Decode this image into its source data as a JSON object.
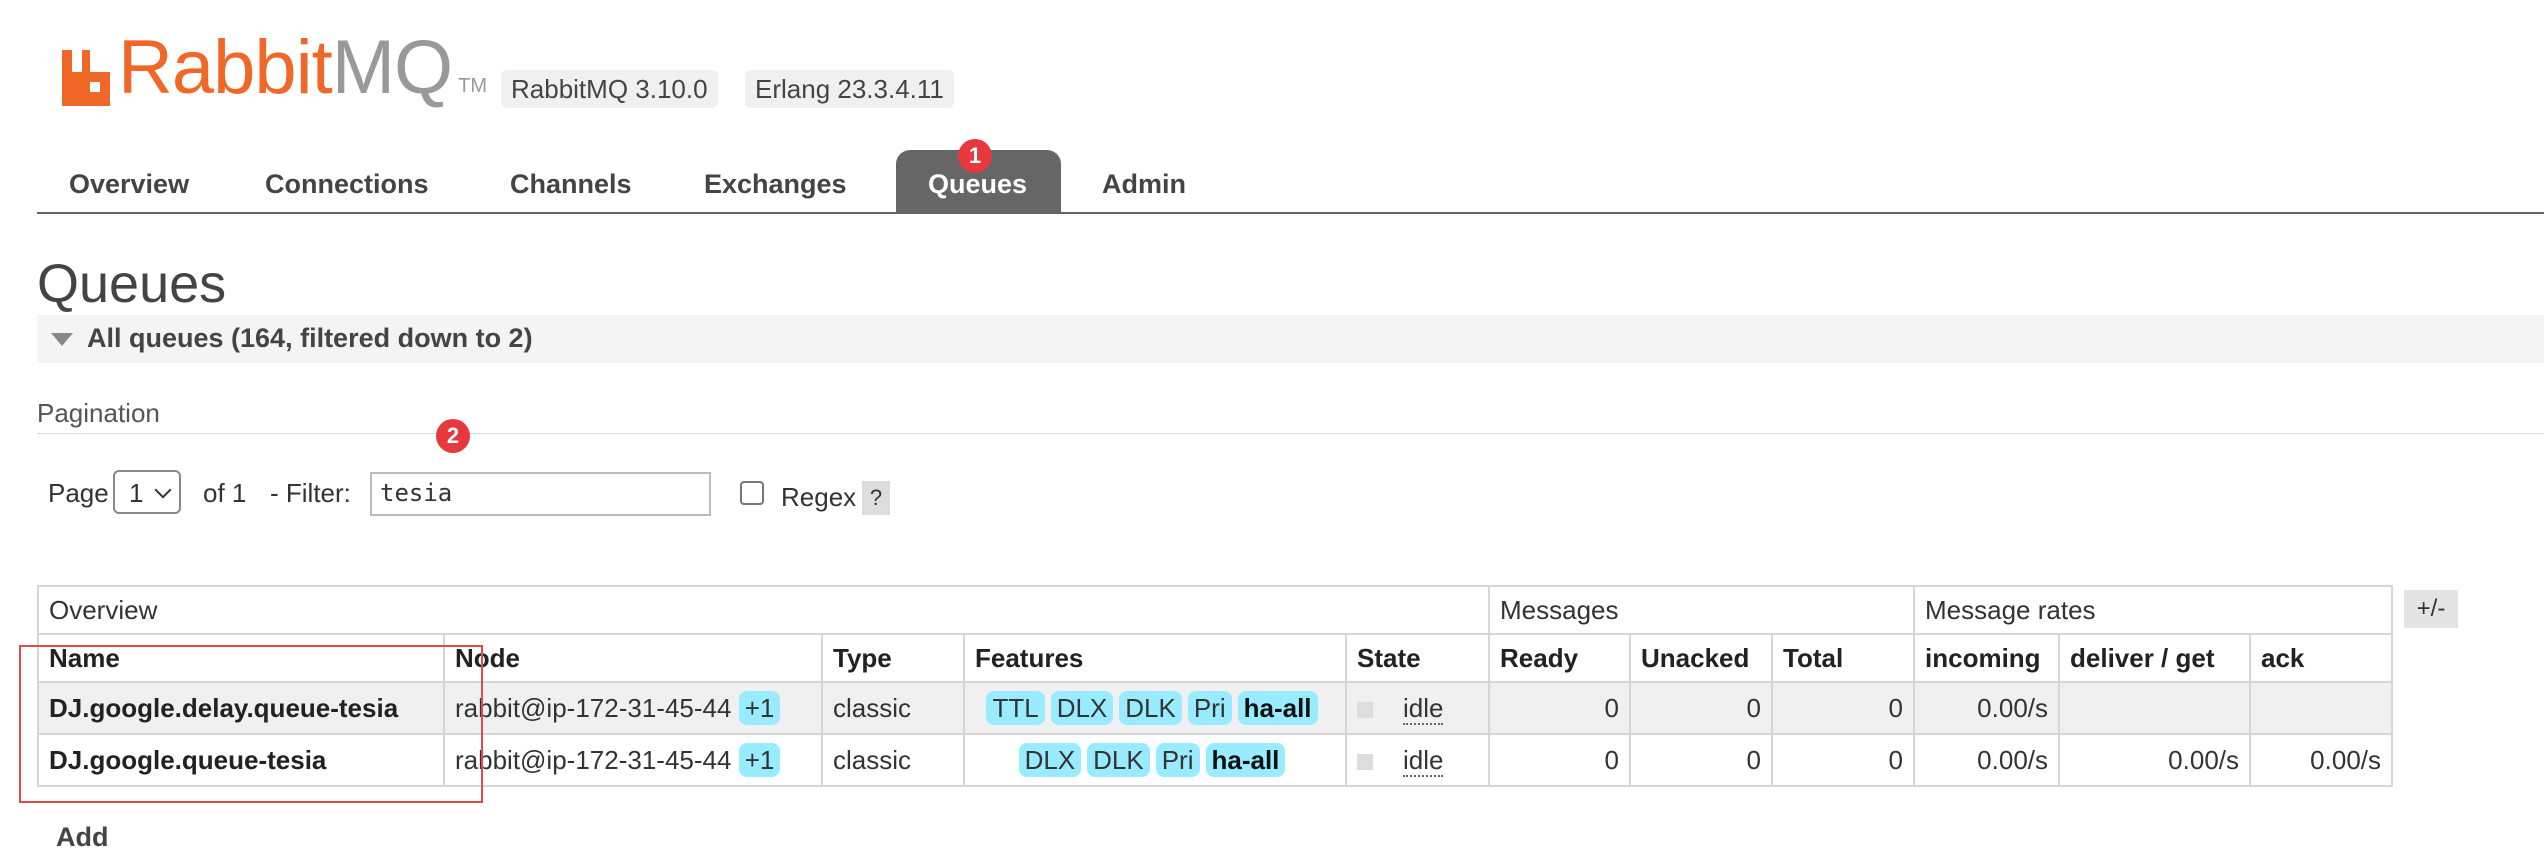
{
  "header": {
    "logo_text_primary": "Rabbit",
    "logo_text_secondary": "MQ",
    "logo_tm": "TM",
    "rabbitmq_version": "RabbitMQ 3.10.0",
    "erlang_version": "Erlang 23.3.4.11"
  },
  "tabs": [
    {
      "label": "Overview"
    },
    {
      "label": "Connections"
    },
    {
      "label": "Channels"
    },
    {
      "label": "Exchanges"
    },
    {
      "label": "Queues",
      "active": true
    },
    {
      "label": "Admin"
    }
  ],
  "annotations": {
    "badge_1": "1",
    "badge_2": "2"
  },
  "page": {
    "title": "Queues",
    "section_label": "All queues (164, filtered down to 2)"
  },
  "pagination": {
    "title": "Pagination",
    "page_label": "Page",
    "page_value": "1",
    "of_label": "of 1",
    "filter_label": "- Filter:",
    "filter_value": "tesia",
    "regex_label": "Regex",
    "help_label": "?"
  },
  "table": {
    "groups": {
      "overview": "Overview",
      "messages": "Messages",
      "message_rates": "Message rates"
    },
    "columns": {
      "name": "Name",
      "node": "Node",
      "type": "Type",
      "features": "Features",
      "state": "State",
      "ready": "Ready",
      "unacked": "Unacked",
      "total": "Total",
      "incoming": "incoming",
      "deliver_get": "deliver / get",
      "ack": "ack"
    },
    "toggle_label": "+/-",
    "rows": [
      {
        "name": "DJ.google.delay.queue-tesia",
        "node": "rabbit@ip-172-31-45-44",
        "node_extra": "+1",
        "type": "classic",
        "features": [
          "TTL",
          "DLX",
          "DLK",
          "Pri",
          "ha-all"
        ],
        "state": "idle",
        "ready": "0",
        "unacked": "0",
        "total": "0",
        "incoming": "0.00/s",
        "deliver_get": "",
        "ack": ""
      },
      {
        "name": "DJ.google.queue-tesia",
        "node": "rabbit@ip-172-31-45-44",
        "node_extra": "+1",
        "type": "classic",
        "features": [
          "DLX",
          "DLK",
          "Pri",
          "ha-all"
        ],
        "state": "idle",
        "ready": "0",
        "unacked": "0",
        "total": "0",
        "incoming": "0.00/s",
        "deliver_get": "0.00/s",
        "ack": "0.00/s"
      }
    ]
  },
  "add_section_label": "Add",
  "colors": {
    "brand_orange": "#f06828",
    "tab_active": "#666666",
    "feature_pill": "#99ebff",
    "annotation_red": "#e5393d"
  }
}
